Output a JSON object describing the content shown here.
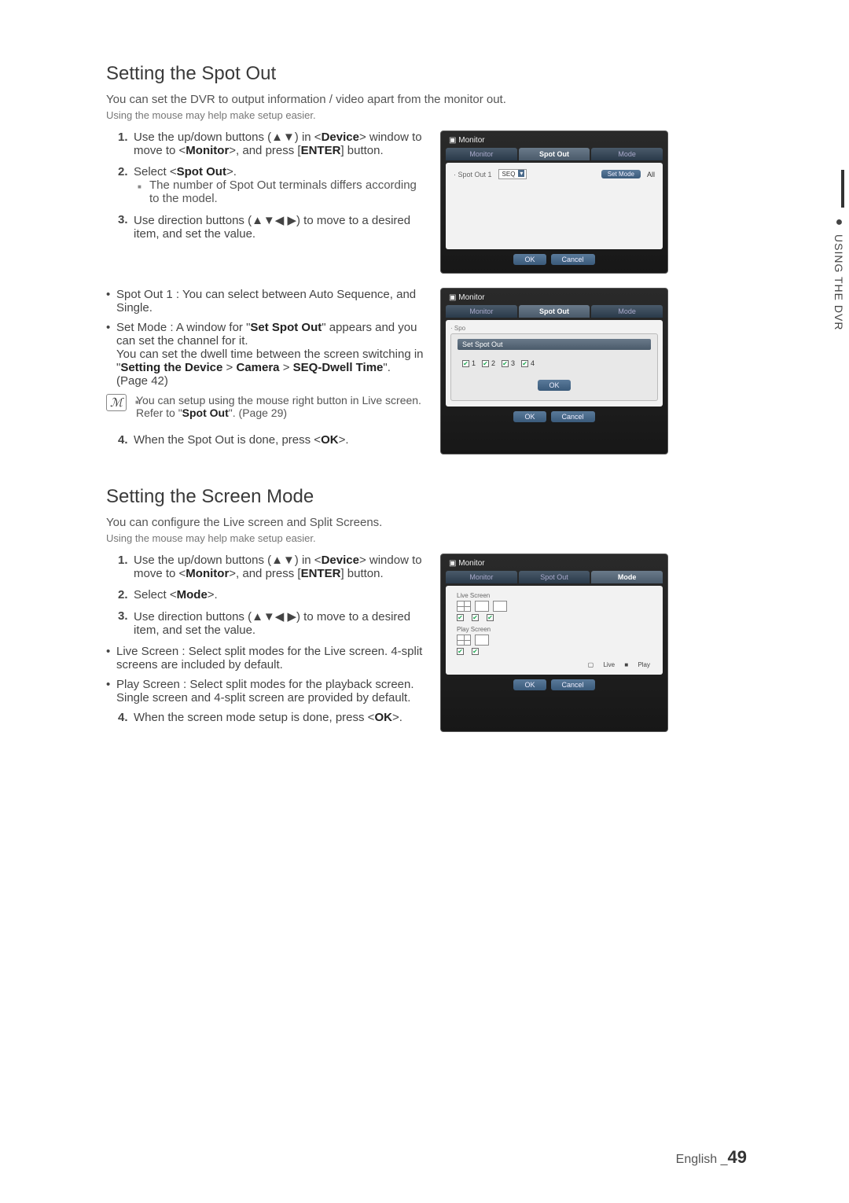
{
  "section1": {
    "title": "Setting the Spot Out",
    "intro": "You can set the DVR to output information / video apart from the monitor out.",
    "sub": "Using the mouse may help make setup easier.",
    "step1_a": "Use the up/down buttons (▲▼) in <",
    "step1_b": "Device",
    "step1_c": "> window to move to <",
    "step1_d": "Monitor",
    "step1_e": ">, and press [",
    "step1_f": "ENTER",
    "step1_g": "] button.",
    "step2_a": "Select <",
    "step2_b": "Spot Out",
    "step2_c": ">.",
    "step2_sub": "The number of Spot Out terminals differs according to the model.",
    "step3": "Use direction buttons (▲▼◀ ▶) to move to a desired item, and set the value.",
    "bullet1": "Spot Out 1 : You can select between Auto Sequence, and Single.",
    "bullet2_a": "Set Mode : A window for \"",
    "bullet2_b": "Set Spot Out",
    "bullet2_c": "\" appears and you can set the channel for it.",
    "bullet2_d": "You can set the dwell time between the screen switching in \"",
    "bullet2_e": "Setting the Device",
    "bullet2_f": " > ",
    "bullet2_g": "Camera",
    "bullet2_h": " > ",
    "bullet2_i": "SEQ-Dwell Time",
    "bullet2_j": "\". (Page 42)",
    "note_a": "You can setup using the mouse right button in Live screen. Refer to \"",
    "note_b": "Spot Out",
    "note_c": "\". (Page 29)",
    "step4_a": "When the Spot Out is done, press <",
    "step4_b": "OK",
    "step4_c": ">."
  },
  "section2": {
    "title": "Setting the Screen Mode",
    "intro": "You can configure the Live screen and Split Screens.",
    "sub": "Using the mouse may help make setup easier.",
    "step1_a": "Use the up/down buttons (▲▼) in <",
    "step1_b": "Device",
    "step1_c": "> window to move to <",
    "step1_d": "Monitor",
    "step1_e": ">, and press [",
    "step1_f": "ENTER",
    "step1_g": "] button.",
    "step2_a": "Select <",
    "step2_b": "Mode",
    "step2_c": ">.",
    "step3": "Use direction buttons (▲▼◀ ▶) to move to a desired item, and set the value.",
    "bullet1": "Live Screen : Select split modes for the Live screen. 4-split screens are included by default.",
    "bullet2": "Play Screen : Select split modes for the playback screen. Single screen and 4-split screen are provided by default.",
    "step4_a": "When the screen mode setup is done, press <",
    "step4_b": "OK",
    "step4_c": ">."
  },
  "dvr": {
    "monitor": "Monitor",
    "tab_monitor": "Monitor",
    "tab_spotout": "Spot Out",
    "tab_mode": "Mode",
    "spotout1": "· Spot Out 1",
    "seq": "SEQ",
    "setmode": "Set Mode",
    "all": "All",
    "ok": "OK",
    "cancel": "Cancel",
    "setspotout": "Set Spot Out",
    "spo": "· Spo",
    "c1": "1",
    "c2": "2",
    "c3": "3",
    "c4": "4",
    "live": "Live Screen",
    "play": "Play Screen",
    "leg_live": "Live",
    "leg_play": "Play"
  },
  "sidetab": "USING THE DVR",
  "footer": {
    "lang": "English",
    "sep": "_",
    "page": "49"
  }
}
